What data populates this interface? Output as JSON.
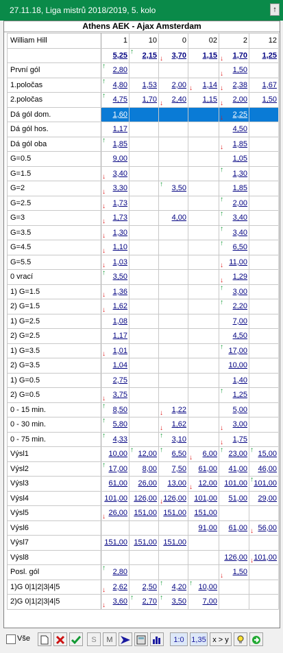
{
  "window": {
    "title": "27.11.18, Liga mistrů 2018/2019, 5. kolo",
    "close_icon": "up-arrow-close"
  },
  "match": {
    "title": "Athens AEK - Ajax Amsterdam"
  },
  "bookmaker": "William Hill",
  "columns": [
    "1",
    "10",
    "0",
    "02",
    "2",
    "12"
  ],
  "main_odds": [
    {
      "v": "5,25",
      "a": ""
    },
    {
      "v": "2,15",
      "a": "up"
    },
    {
      "v": "3,70",
      "a": "down"
    },
    {
      "v": "1,15",
      "a": ""
    },
    {
      "v": "1,70",
      "a": "down"
    },
    {
      "v": "1,25",
      "a": ""
    }
  ],
  "rows": [
    {
      "label": "První gól",
      "cells": [
        {
          "v": "2,80",
          "a": "up"
        },
        {
          "v": "",
          "a": ""
        },
        {
          "v": "",
          "a": ""
        },
        {
          "v": "",
          "a": ""
        },
        {
          "v": "1,50",
          "a": "down"
        },
        {
          "v": "",
          "a": ""
        }
      ]
    },
    {
      "label": "1.poločas",
      "cells": [
        {
          "v": "4,80",
          "a": "up"
        },
        {
          "v": "1,53",
          "a": ""
        },
        {
          "v": "2,00",
          "a": ""
        },
        {
          "v": "1,14",
          "a": "down"
        },
        {
          "v": "2,38",
          "a": "down"
        },
        {
          "v": "1,67",
          "a": ""
        }
      ]
    },
    {
      "label": "2.poločas",
      "cells": [
        {
          "v": "4,75",
          "a": "up"
        },
        {
          "v": "1,70",
          "a": ""
        },
        {
          "v": "2,40",
          "a": "down"
        },
        {
          "v": "1,15",
          "a": ""
        },
        {
          "v": "2,00",
          "a": "down"
        },
        {
          "v": "1,50",
          "a": ""
        }
      ]
    },
    {
      "label": "Dá gól dom.",
      "highlight": true,
      "cells": [
        {
          "v": "1,60",
          "a": ""
        },
        {
          "v": "",
          "a": ""
        },
        {
          "v": "",
          "a": ""
        },
        {
          "v": "",
          "a": ""
        },
        {
          "v": "2,25",
          "a": "down"
        },
        {
          "v": "",
          "a": ""
        }
      ]
    },
    {
      "label": "Dá gól hos.",
      "cells": [
        {
          "v": "1,17",
          "a": ""
        },
        {
          "v": "",
          "a": ""
        },
        {
          "v": "",
          "a": ""
        },
        {
          "v": "",
          "a": ""
        },
        {
          "v": "4,50",
          "a": ""
        },
        {
          "v": "",
          "a": ""
        }
      ]
    },
    {
      "label": "Dá gól oba",
      "cells": [
        {
          "v": "1,85",
          "a": "up"
        },
        {
          "v": "",
          "a": ""
        },
        {
          "v": "",
          "a": ""
        },
        {
          "v": "",
          "a": ""
        },
        {
          "v": "1,85",
          "a": "down"
        },
        {
          "v": "",
          "a": ""
        }
      ]
    },
    {
      "label": "G=0.5",
      "cells": [
        {
          "v": "9,00",
          "a": ""
        },
        {
          "v": "",
          "a": ""
        },
        {
          "v": "",
          "a": ""
        },
        {
          "v": "",
          "a": ""
        },
        {
          "v": "1,05",
          "a": ""
        },
        {
          "v": "",
          "a": ""
        }
      ]
    },
    {
      "label": "G=1.5",
      "cells": [
        {
          "v": "3,40",
          "a": "down"
        },
        {
          "v": "",
          "a": ""
        },
        {
          "v": "",
          "a": ""
        },
        {
          "v": "",
          "a": ""
        },
        {
          "v": "1,30",
          "a": "up"
        },
        {
          "v": "",
          "a": ""
        }
      ]
    },
    {
      "label": "G=2",
      "cells": [
        {
          "v": "3,30",
          "a": "down"
        },
        {
          "v": "",
          "a": ""
        },
        {
          "v": "3,50",
          "a": "up"
        },
        {
          "v": "",
          "a": ""
        },
        {
          "v": "1,85",
          "a": ""
        },
        {
          "v": "",
          "a": ""
        }
      ]
    },
    {
      "label": "G=2.5",
      "cells": [
        {
          "v": "1,73",
          "a": "down"
        },
        {
          "v": "",
          "a": ""
        },
        {
          "v": "",
          "a": ""
        },
        {
          "v": "",
          "a": ""
        },
        {
          "v": "2,00",
          "a": "up"
        },
        {
          "v": "",
          "a": ""
        }
      ]
    },
    {
      "label": "G=3",
      "cells": [
        {
          "v": "1,73",
          "a": "down"
        },
        {
          "v": "",
          "a": ""
        },
        {
          "v": "4,00",
          "a": ""
        },
        {
          "v": "",
          "a": ""
        },
        {
          "v": "3,40",
          "a": "up"
        },
        {
          "v": "",
          "a": ""
        }
      ]
    },
    {
      "label": "G=3.5",
      "cells": [
        {
          "v": "1,30",
          "a": "down"
        },
        {
          "v": "",
          "a": ""
        },
        {
          "v": "",
          "a": ""
        },
        {
          "v": "",
          "a": ""
        },
        {
          "v": "3,40",
          "a": "up"
        },
        {
          "v": "",
          "a": ""
        }
      ]
    },
    {
      "label": "G=4.5",
      "cells": [
        {
          "v": "1,10",
          "a": "down"
        },
        {
          "v": "",
          "a": ""
        },
        {
          "v": "",
          "a": ""
        },
        {
          "v": "",
          "a": ""
        },
        {
          "v": "6,50",
          "a": "up"
        },
        {
          "v": "",
          "a": ""
        }
      ]
    },
    {
      "label": "G=5.5",
      "cells": [
        {
          "v": "1,03",
          "a": "down"
        },
        {
          "v": "",
          "a": ""
        },
        {
          "v": "",
          "a": ""
        },
        {
          "v": "",
          "a": ""
        },
        {
          "v": "11,00",
          "a": "down"
        },
        {
          "v": "",
          "a": ""
        }
      ]
    },
    {
      "label": "0 vrací",
      "cells": [
        {
          "v": "3,50",
          "a": "up"
        },
        {
          "v": "",
          "a": ""
        },
        {
          "v": "",
          "a": ""
        },
        {
          "v": "",
          "a": ""
        },
        {
          "v": "1,29",
          "a": "down"
        },
        {
          "v": "",
          "a": ""
        }
      ]
    },
    {
      "label": "1) G=1.5",
      "cells": [
        {
          "v": "1,36",
          "a": "down"
        },
        {
          "v": "",
          "a": ""
        },
        {
          "v": "",
          "a": ""
        },
        {
          "v": "",
          "a": ""
        },
        {
          "v": "3,00",
          "a": "up"
        },
        {
          "v": "",
          "a": ""
        }
      ]
    },
    {
      "label": "2) G=1.5",
      "cells": [
        {
          "v": "1,62",
          "a": "down"
        },
        {
          "v": "",
          "a": ""
        },
        {
          "v": "",
          "a": ""
        },
        {
          "v": "",
          "a": ""
        },
        {
          "v": "2,20",
          "a": "up"
        },
        {
          "v": "",
          "a": ""
        }
      ]
    },
    {
      "label": "1) G=2.5",
      "cells": [
        {
          "v": "1,08",
          "a": ""
        },
        {
          "v": "",
          "a": ""
        },
        {
          "v": "",
          "a": ""
        },
        {
          "v": "",
          "a": ""
        },
        {
          "v": "7,00",
          "a": ""
        },
        {
          "v": "",
          "a": ""
        }
      ]
    },
    {
      "label": "2) G=2.5",
      "cells": [
        {
          "v": "1,17",
          "a": ""
        },
        {
          "v": "",
          "a": ""
        },
        {
          "v": "",
          "a": ""
        },
        {
          "v": "",
          "a": ""
        },
        {
          "v": "4,50",
          "a": ""
        },
        {
          "v": "",
          "a": ""
        }
      ]
    },
    {
      "label": "1) G=3.5",
      "cells": [
        {
          "v": "1,01",
          "a": "down"
        },
        {
          "v": "",
          "a": ""
        },
        {
          "v": "",
          "a": ""
        },
        {
          "v": "",
          "a": ""
        },
        {
          "v": "17,00",
          "a": "up"
        },
        {
          "v": "",
          "a": ""
        }
      ]
    },
    {
      "label": "2) G=3.5",
      "cells": [
        {
          "v": "1,04",
          "a": ""
        },
        {
          "v": "",
          "a": ""
        },
        {
          "v": "",
          "a": ""
        },
        {
          "v": "",
          "a": ""
        },
        {
          "v": "10,00",
          "a": ""
        },
        {
          "v": "",
          "a": ""
        }
      ]
    },
    {
      "label": "1) G=0.5",
      "cells": [
        {
          "v": "2,75",
          "a": ""
        },
        {
          "v": "",
          "a": ""
        },
        {
          "v": "",
          "a": ""
        },
        {
          "v": "",
          "a": ""
        },
        {
          "v": "1,40",
          "a": ""
        },
        {
          "v": "",
          "a": ""
        }
      ]
    },
    {
      "label": "2) G=0.5",
      "cells": [
        {
          "v": "3,75",
          "a": "down"
        },
        {
          "v": "",
          "a": ""
        },
        {
          "v": "",
          "a": ""
        },
        {
          "v": "",
          "a": ""
        },
        {
          "v": "1,25",
          "a": "up"
        },
        {
          "v": "",
          "a": ""
        }
      ]
    },
    {
      "label": "0 - 15 min.",
      "cells": [
        {
          "v": "8,50",
          "a": "up"
        },
        {
          "v": "",
          "a": ""
        },
        {
          "v": "1,22",
          "a": "down"
        },
        {
          "v": "",
          "a": ""
        },
        {
          "v": "5,00",
          "a": ""
        },
        {
          "v": "",
          "a": ""
        }
      ]
    },
    {
      "label": "0 - 30 min.",
      "cells": [
        {
          "v": "5,80",
          "a": "up"
        },
        {
          "v": "",
          "a": ""
        },
        {
          "v": "1,62",
          "a": "down"
        },
        {
          "v": "",
          "a": ""
        },
        {
          "v": "3,00",
          "a": "down"
        },
        {
          "v": "",
          "a": ""
        }
      ]
    },
    {
      "label": "0 - 75 min.",
      "cells": [
        {
          "v": "4,33",
          "a": "up"
        },
        {
          "v": "",
          "a": ""
        },
        {
          "v": "3,10",
          "a": "up"
        },
        {
          "v": "",
          "a": ""
        },
        {
          "v": "1,75",
          "a": "down"
        },
        {
          "v": "",
          "a": ""
        }
      ]
    },
    {
      "label": "Výsl1",
      "cells": [
        {
          "v": "10,00",
          "a": ""
        },
        {
          "v": "12,00",
          "a": "up"
        },
        {
          "v": "6,50",
          "a": "up"
        },
        {
          "v": "6,00",
          "a": "down"
        },
        {
          "v": "23,00",
          "a": "up"
        },
        {
          "v": "15,00",
          "a": "up"
        }
      ]
    },
    {
      "label": "Výsl2",
      "cells": [
        {
          "v": "17,00",
          "a": "up"
        },
        {
          "v": "8,00",
          "a": ""
        },
        {
          "v": "7,50",
          "a": ""
        },
        {
          "v": "61,00",
          "a": ""
        },
        {
          "v": "41,00",
          "a": ""
        },
        {
          "v": "46,00",
          "a": ""
        }
      ]
    },
    {
      "label": "Výsl3",
      "cells": [
        {
          "v": "61,00",
          "a": ""
        },
        {
          "v": "26,00",
          "a": ""
        },
        {
          "v": "13,00",
          "a": ""
        },
        {
          "v": "12,00",
          "a": "down"
        },
        {
          "v": "101,00",
          "a": ""
        },
        {
          "v": "101,00",
          "a": "up"
        }
      ]
    },
    {
      "label": "Výsl4",
      "cells": [
        {
          "v": "101,00",
          "a": ""
        },
        {
          "v": "126,00",
          "a": ""
        },
        {
          "v": "126,00",
          "a": "down"
        },
        {
          "v": "101,00",
          "a": ""
        },
        {
          "v": "51,00",
          "a": ""
        },
        {
          "v": "29,00",
          "a": ""
        }
      ]
    },
    {
      "label": "Výsl5",
      "cells": [
        {
          "v": "26,00",
          "a": "down"
        },
        {
          "v": "151,00",
          "a": ""
        },
        {
          "v": "151,00",
          "a": ""
        },
        {
          "v": "151,00",
          "a": ""
        },
        {
          "v": "",
          "a": ""
        },
        {
          "v": "",
          "a": ""
        }
      ]
    },
    {
      "label": "Výsl6",
      "cells": [
        {
          "v": "",
          "a": ""
        },
        {
          "v": "",
          "a": ""
        },
        {
          "v": "",
          "a": ""
        },
        {
          "v": "91,00",
          "a": ""
        },
        {
          "v": "61,00",
          "a": ""
        },
        {
          "v": "56,00",
          "a": "down"
        }
      ]
    },
    {
      "label": "Výsl7",
      "cells": [
        {
          "v": "151,00",
          "a": ""
        },
        {
          "v": "151,00",
          "a": ""
        },
        {
          "v": "151,00",
          "a": ""
        },
        {
          "v": "",
          "a": ""
        },
        {
          "v": "",
          "a": ""
        },
        {
          "v": "",
          "a": ""
        }
      ]
    },
    {
      "label": "Výsl8",
      "cells": [
        {
          "v": "",
          "a": ""
        },
        {
          "v": "",
          "a": ""
        },
        {
          "v": "",
          "a": ""
        },
        {
          "v": "",
          "a": ""
        },
        {
          "v": "126,00",
          "a": ""
        },
        {
          "v": "101,00",
          "a": "down"
        }
      ]
    },
    {
      "label": "Posl. gól",
      "cells": [
        {
          "v": "2,80",
          "a": "up"
        },
        {
          "v": "",
          "a": ""
        },
        {
          "v": "",
          "a": ""
        },
        {
          "v": "",
          "a": ""
        },
        {
          "v": "1,50",
          "a": "down"
        },
        {
          "v": "",
          "a": ""
        }
      ]
    },
    {
      "label": "1)G 0|1|2|3|4|5",
      "cells": [
        {
          "v": "2,62",
          "a": "down"
        },
        {
          "v": "2,50",
          "a": ""
        },
        {
          "v": "4,20",
          "a": "up"
        },
        {
          "v": "10,00",
          "a": "up"
        },
        {
          "v": "",
          "a": ""
        },
        {
          "v": "",
          "a": ""
        }
      ]
    },
    {
      "label": "2)G 0|1|2|3|4|5",
      "cells": [
        {
          "v": "3,60",
          "a": "down"
        },
        {
          "v": "2,70",
          "a": "up"
        },
        {
          "v": "3,50",
          "a": "up"
        },
        {
          "v": "7,00",
          "a": ""
        },
        {
          "v": "",
          "a": ""
        },
        {
          "v": "",
          "a": ""
        }
      ]
    }
  ],
  "toolbar": {
    "all_label": "Vše",
    "s_label": "S",
    "m_label": "M",
    "score_label": "1:0",
    "odds_label": "1,35",
    "compare_label": "x > y",
    "icons": [
      "new-document-icon",
      "delete-icon",
      "check-icon",
      "s-button",
      "m-button",
      "arrow-icon",
      "calculator-icon",
      "chart-icon",
      "score-button",
      "odds-button",
      "compare-button",
      "bulb-icon",
      "go-icon"
    ]
  }
}
